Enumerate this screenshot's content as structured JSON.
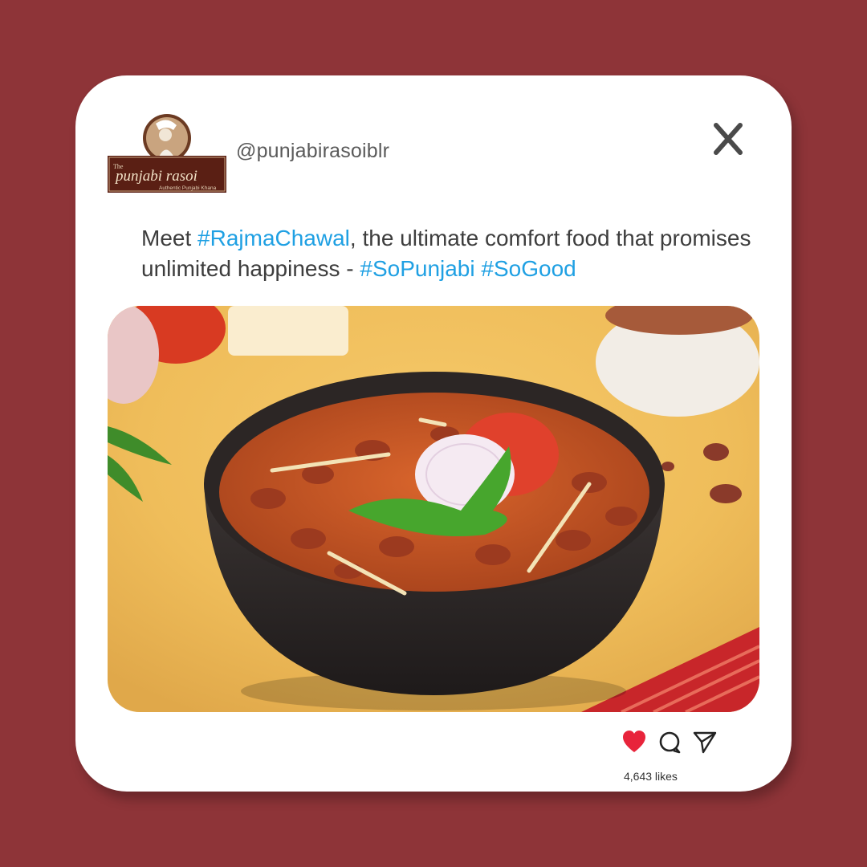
{
  "account": {
    "handle": "@punjabirasoiblr",
    "logo_top": "The",
    "logo_name": "punjabi rasoi",
    "logo_tag": "Authentic Punjabi Khana"
  },
  "post": {
    "caption": {
      "t1": "Meet ",
      "tag1": "#RajmaChawal",
      "t2": ", the ultimate comfort food that promises unlimited happiness - ",
      "tag2": "#SoPunjabi",
      "t3": " ",
      "tag3": "#SoGood"
    },
    "likes": "4,643 likes",
    "image_subject": "bowl of rajma curry"
  },
  "icons": {
    "close": "close-x-icon",
    "like": "heart-icon",
    "comment": "comment-icon",
    "share": "send-icon"
  },
  "colors": {
    "background": "#8e3438",
    "hashtag": "#1fa0e3",
    "heart": "#e8243b"
  }
}
